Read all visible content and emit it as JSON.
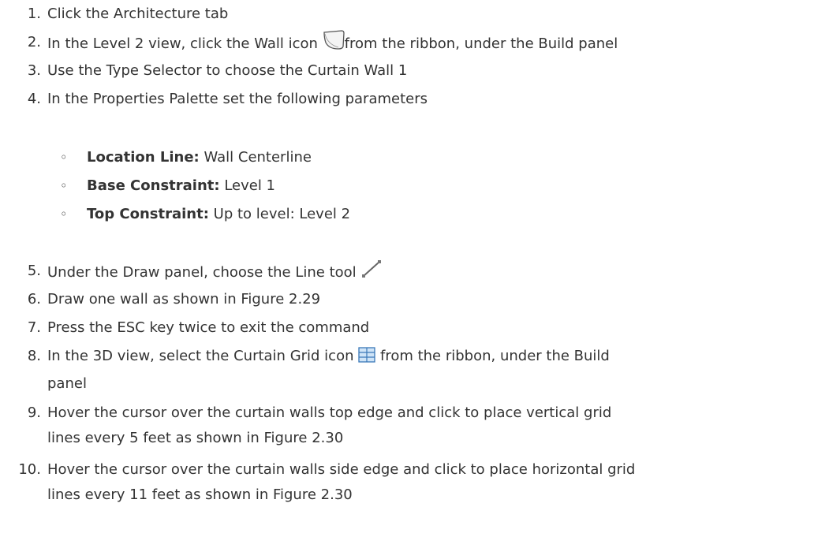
{
  "steps": [
    {
      "num": "1.",
      "text": "Click the Architecture tab"
    },
    {
      "num": "2.",
      "text_before": "In the Level 2 view, click the Wall icon",
      "text_after": "from the ribbon, under the Build panel"
    },
    {
      "num": "3.",
      "text": "Use the Type Selector to choose the Curtain Wall 1"
    },
    {
      "num": "4.",
      "text": "In the Properties Palette set the following parameters"
    },
    {
      "num": "5.",
      "text": "Under the Draw panel, choose the Line tool"
    },
    {
      "num": "6.",
      "text": "Draw one wall as shown in Figure 2.29"
    },
    {
      "num": "7.",
      "text": "Press the ESC key twice to exit the command"
    },
    {
      "num": "8.",
      "text_before": "In the 3D view, select the Curtain Grid icon",
      "text_after": "from the ribbon, under the Build",
      "text_line2": "panel"
    },
    {
      "num": "9.",
      "text_line1": "Hover the cursor over the curtain walls top edge and click to place vertical grid",
      "text_line2": "lines every 5 feet as shown in Figure 2.30"
    },
    {
      "num": "10.",
      "text_line1": "Hover the cursor over the curtain walls side edge and click to place horizontal grid",
      "text_line2": "lines every 11 feet as shown in Figure 2.30"
    }
  ],
  "parameters": [
    {
      "label": "Location Line:",
      "value": "Wall Centerline"
    },
    {
      "label": "Base Constraint:",
      "value": "Level 1"
    },
    {
      "label": "Top Constraint:",
      "value": "Up to level: Level 2"
    }
  ],
  "bullet_glyph": "◦",
  "icons": [
    "wall-icon",
    "line-tool-icon",
    "curtain-grid-icon"
  ]
}
